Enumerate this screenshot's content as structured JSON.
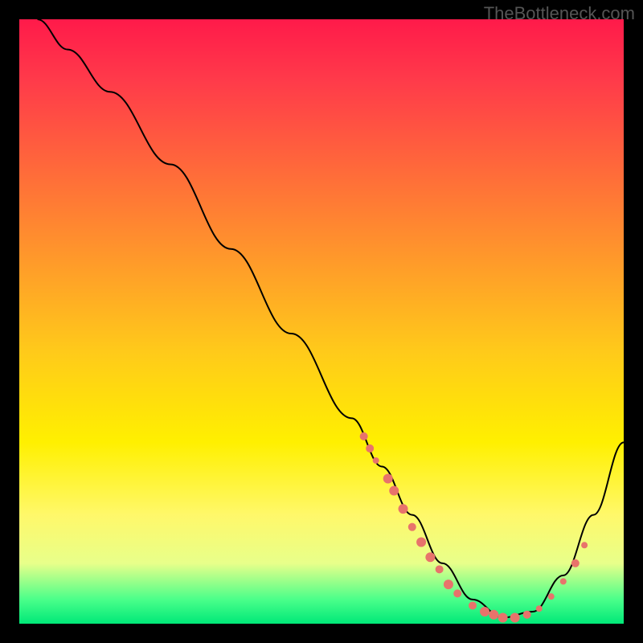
{
  "watermark": "TheBottleneck.com",
  "chart_data": {
    "type": "line",
    "title": "",
    "xlabel": "",
    "ylabel": "",
    "xlim": [
      0,
      100
    ],
    "ylim": [
      0,
      100
    ],
    "background": "gradient-red-yellow-green",
    "series": [
      {
        "name": "bottleneck-curve",
        "x": [
          3,
          8,
          15,
          25,
          35,
          45,
          55,
          60,
          65,
          70,
          75,
          80,
          85,
          90,
          95,
          100
        ],
        "y": [
          100,
          95,
          88,
          76,
          62,
          48,
          34,
          26,
          18,
          10,
          4,
          1,
          2,
          8,
          18,
          30
        ]
      }
    ],
    "points": [
      {
        "name": "cluster",
        "x": 57,
        "y": 31,
        "r": 5
      },
      {
        "name": "cluster",
        "x": 58,
        "y": 29,
        "r": 5
      },
      {
        "name": "cluster",
        "x": 59,
        "y": 27,
        "r": 4
      },
      {
        "name": "cluster",
        "x": 61,
        "y": 24,
        "r": 6
      },
      {
        "name": "cluster",
        "x": 62,
        "y": 22,
        "r": 6
      },
      {
        "name": "cluster",
        "x": 63.5,
        "y": 19,
        "r": 6
      },
      {
        "name": "cluster",
        "x": 65,
        "y": 16,
        "r": 5
      },
      {
        "name": "cluster",
        "x": 66.5,
        "y": 13.5,
        "r": 6
      },
      {
        "name": "cluster",
        "x": 68,
        "y": 11,
        "r": 6
      },
      {
        "name": "cluster",
        "x": 69.5,
        "y": 9,
        "r": 5
      },
      {
        "name": "cluster",
        "x": 71,
        "y": 6.5,
        "r": 6
      },
      {
        "name": "cluster",
        "x": 72.5,
        "y": 5,
        "r": 5
      },
      {
        "name": "cluster",
        "x": 75,
        "y": 3,
        "r": 5
      },
      {
        "name": "cluster",
        "x": 77,
        "y": 2,
        "r": 6
      },
      {
        "name": "cluster",
        "x": 78.5,
        "y": 1.5,
        "r": 6
      },
      {
        "name": "cluster",
        "x": 80,
        "y": 1,
        "r": 6
      },
      {
        "name": "cluster",
        "x": 82,
        "y": 1,
        "r": 6
      },
      {
        "name": "cluster",
        "x": 84,
        "y": 1.5,
        "r": 5
      },
      {
        "name": "cluster",
        "x": 86,
        "y": 2.5,
        "r": 4
      },
      {
        "name": "cluster",
        "x": 88,
        "y": 4.5,
        "r": 4
      },
      {
        "name": "cluster",
        "x": 90,
        "y": 7,
        "r": 4
      },
      {
        "name": "cluster",
        "x": 92,
        "y": 10,
        "r": 5
      },
      {
        "name": "cluster",
        "x": 93.5,
        "y": 13,
        "r": 4
      }
    ]
  }
}
